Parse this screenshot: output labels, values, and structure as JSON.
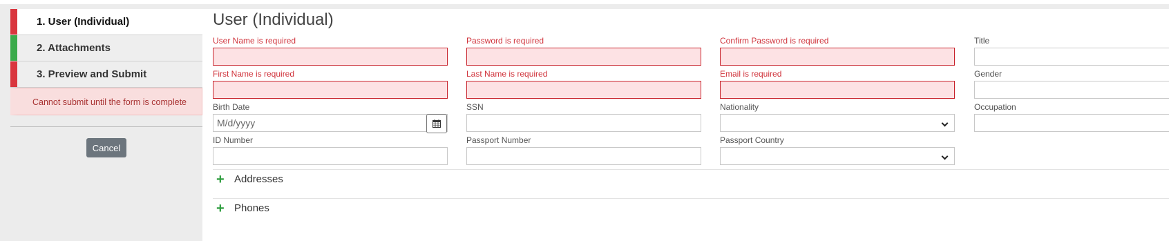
{
  "steps": [
    {
      "label": "1. User (Individual)",
      "status_color": "#d9363e"
    },
    {
      "label": "2. Attachments",
      "status_color": "#3aaa4a"
    },
    {
      "label": "3. Preview and Submit",
      "status_color": "#d9363e"
    }
  ],
  "notice": "Cannot submit until the form is complete",
  "cancel_label": "Cancel",
  "page_title": "User (Individual)",
  "fields": {
    "username": {
      "label": "User Name is required"
    },
    "password": {
      "label": "Password is required"
    },
    "confirm_password": {
      "label": "Confirm Password is required"
    },
    "title": {
      "label": "Title"
    },
    "first_name": {
      "label": "First Name is required"
    },
    "last_name": {
      "label": "Last Name is required"
    },
    "email": {
      "label": "Email is required"
    },
    "gender": {
      "label": "Gender"
    },
    "birth_date": {
      "label": "Birth Date",
      "placeholder": "M/d/yyyy"
    },
    "ssn": {
      "label": "SSN"
    },
    "nationality": {
      "label": "Nationality",
      "value": ""
    },
    "occupation": {
      "label": "Occupation"
    },
    "id_number": {
      "label": "ID Number"
    },
    "passport_number": {
      "label": "Passport Number"
    },
    "passport_country": {
      "label": "Passport Country",
      "value": ""
    }
  },
  "sections": [
    {
      "title": "Addresses",
      "icon": "plus-icon"
    },
    {
      "title": "Phones",
      "icon": "plus-icon"
    }
  ],
  "colors": {
    "error": "#d0343c",
    "error_bg": "#fde2e4",
    "plus": "#2e9d3f"
  }
}
